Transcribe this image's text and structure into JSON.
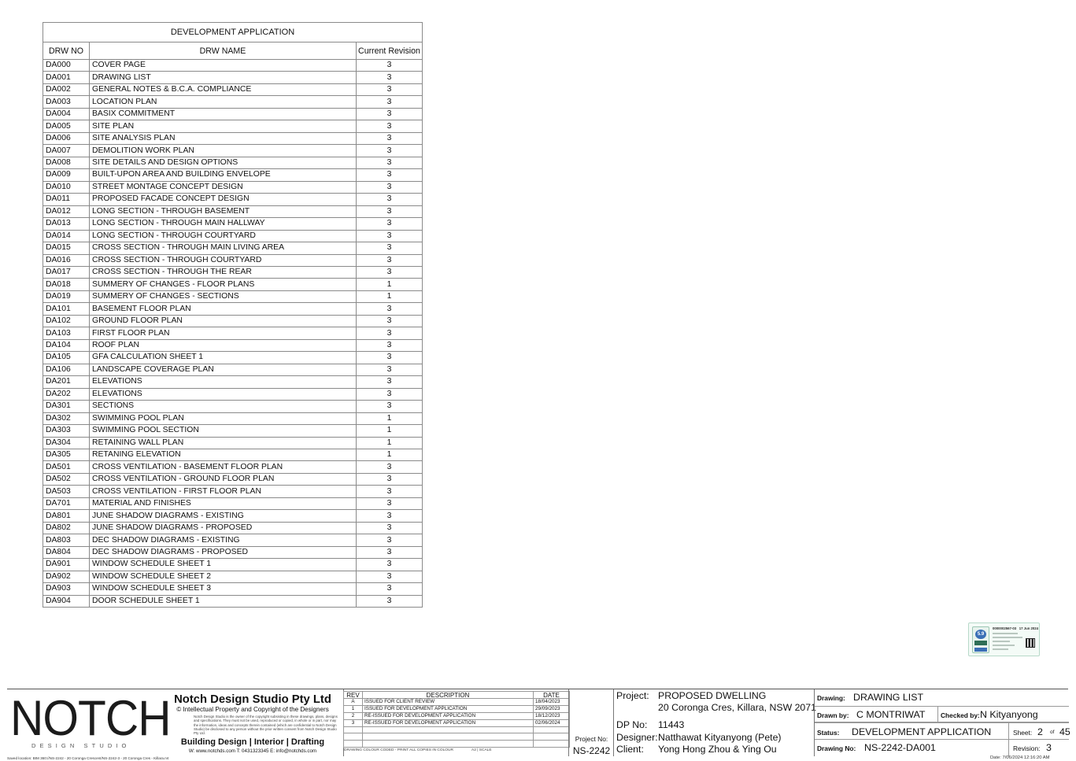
{
  "drawing_list": {
    "caption": "DEVELOPMENT APPLICATION",
    "headers": {
      "no": "DRW NO",
      "name": "DRW NAME",
      "rev": "Current Revision"
    },
    "rows": [
      {
        "no": "DA000",
        "name": "COVER PAGE",
        "rev": "3"
      },
      {
        "no": "DA001",
        "name": "DRAWING LIST",
        "rev": "3"
      },
      {
        "no": "DA002",
        "name": "GENERAL NOTES & B.C.A. COMPLIANCE",
        "rev": "3"
      },
      {
        "no": "DA003",
        "name": "LOCATION PLAN",
        "rev": "3"
      },
      {
        "no": "DA004",
        "name": "BASIX COMMITMENT",
        "rev": "3"
      },
      {
        "no": "DA005",
        "name": "SITE PLAN",
        "rev": "3"
      },
      {
        "no": "DA006",
        "name": "SITE ANALYSIS PLAN",
        "rev": "3"
      },
      {
        "no": "DA007",
        "name": "DEMOLITION WORK PLAN",
        "rev": "3"
      },
      {
        "no": "DA008",
        "name": "SITE DETAILS AND DESIGN OPTIONS",
        "rev": "3"
      },
      {
        "no": "DA009",
        "name": "BUILT-UPON AREA AND BUILDING ENVELOPE",
        "rev": "3"
      },
      {
        "no": "DA010",
        "name": "STREET MONTAGE CONCEPT DESIGN",
        "rev": "3"
      },
      {
        "no": "DA011",
        "name": "PROPOSED FACADE CONCEPT DESIGN",
        "rev": "3"
      },
      {
        "no": "DA012",
        "name": "LONG SECTION - THROUGH BASEMENT",
        "rev": "3"
      },
      {
        "no": "DA013",
        "name": "LONG SECTION - THROUGH MAIN HALLWAY",
        "rev": "3"
      },
      {
        "no": "DA014",
        "name": "LONG SECTION - THROUGH COURTYARD",
        "rev": "3"
      },
      {
        "no": "DA015",
        "name": "CROSS SECTION - THROUGH MAIN LIVING AREA",
        "rev": "3"
      },
      {
        "no": "DA016",
        "name": "CROSS SECTION - THROUGH COURTYARD",
        "rev": "3"
      },
      {
        "no": "DA017",
        "name": "CROSS SECTION - THROUGH THE REAR",
        "rev": "3"
      },
      {
        "no": "DA018",
        "name": "SUMMERY OF CHANGES - FLOOR PLANS",
        "rev": "1"
      },
      {
        "no": "DA019",
        "name": "SUMMERY OF CHANGES - SECTIONS",
        "rev": "1"
      },
      {
        "no": "DA101",
        "name": "BASEMENT FLOOR PLAN",
        "rev": "3"
      },
      {
        "no": "DA102",
        "name": "GROUND FLOOR PLAN",
        "rev": "3"
      },
      {
        "no": "DA103",
        "name": "FIRST FLOOR PLAN",
        "rev": "3"
      },
      {
        "no": "DA104",
        "name": "ROOF PLAN",
        "rev": "3"
      },
      {
        "no": "DA105",
        "name": "GFA CALCULATION SHEET 1",
        "rev": "3"
      },
      {
        "no": "DA106",
        "name": "LANDSCAPE COVERAGE PLAN",
        "rev": "3"
      },
      {
        "no": "DA201",
        "name": "ELEVATIONS",
        "rev": "3"
      },
      {
        "no": "DA202",
        "name": "ELEVATIONS",
        "rev": "3"
      },
      {
        "no": "DA301",
        "name": "SECTIONS",
        "rev": "3"
      },
      {
        "no": "DA302",
        "name": "SWIMMING POOL PLAN",
        "rev": "1"
      },
      {
        "no": "DA303",
        "name": "SWIMMING POOL SECTION",
        "rev": "1"
      },
      {
        "no": "DA304",
        "name": "RETAINING WALL PLAN",
        "rev": "1"
      },
      {
        "no": "DA305",
        "name": "RETANING ELEVATION",
        "rev": "1"
      },
      {
        "no": "DA501",
        "name": "CROSS VENTILATION - BASEMENT FLOOR PLAN",
        "rev": "3"
      },
      {
        "no": "DA502",
        "name": "CROSS VENTILATION - GROUND FLOOR PLAN",
        "rev": "3"
      },
      {
        "no": "DA503",
        "name": "CROSS VENTILATION - FIRST FLOOR PLAN",
        "rev": "3"
      },
      {
        "no": "DA701",
        "name": "MATERIAL AND FINISHES",
        "rev": "3"
      },
      {
        "no": "DA801",
        "name": "JUNE SHADOW DIAGRAMS - EXISTING",
        "rev": "3"
      },
      {
        "no": "DA802",
        "name": "JUNE SHADOW DIAGRAMS - PROPOSED",
        "rev": "3"
      },
      {
        "no": "DA803",
        "name": "DEC SHADOW DIAGRAMS - EXISTING",
        "rev": "3"
      },
      {
        "no": "DA804",
        "name": "DEC SHADOW DIAGRAMS - PROPOSED",
        "rev": "3"
      },
      {
        "no": "DA901",
        "name": "WINDOW SCHEDULE SHEET 1",
        "rev": "3"
      },
      {
        "no": "DA902",
        "name": "WINDOW SCHEDULE SHEET 2",
        "rev": "3"
      },
      {
        "no": "DA903",
        "name": "WINDOW SCHEDULE SHEET 3",
        "rev": "3"
      },
      {
        "no": "DA904",
        "name": "DOOR SCHEDULE SHEET 1",
        "rev": "3"
      }
    ]
  },
  "basix_stamp": {
    "cert_no": "0000002567-03",
    "cert_date": "17 Jun 2024",
    "rating": "5.9",
    "brand": "HOUSE"
  },
  "logo": {
    "word": "NOTCH",
    "sub": "DESIGN STUDIO"
  },
  "company": {
    "name": "Notch Design Studio Pty Ltd",
    "copyright": "© Intellectual Property and Copyright of the Designers",
    "disclaimer": "Notch Design Studio is the owner of the copyright subsisting in these drawings, plans, designs and specifications. They must not be used, reproduced or copied, in whole or in part, nor may the information, ideas and concepts therein contained (which are confidential to Notch Design Studio) be disclosed to any person without the prior written consent from Notch Design Studio Pty Ltd.",
    "services": "Building Design | Interior | Drafting",
    "contact": "W: www.notchds.com  T: 0431323345  E: info@notchds.com"
  },
  "revisions": {
    "headers": {
      "rev": "REV",
      "desc": "DESCRIPTION",
      "date": "DATE"
    },
    "rows": [
      {
        "rev": "A",
        "desc": "ISSUED FOR CLIENT REVIEW",
        "date": "18/04/2023"
      },
      {
        "rev": "1",
        "desc": "ISSUED FOR DEVELOPMENT APPLICATION",
        "date": "29/09/2023"
      },
      {
        "rev": "2",
        "desc": "RE-ISSUED FOR DEVELOPMENT APPLICATION",
        "date": "18/12/2023"
      },
      {
        "rev": "3",
        "desc": "RE-ISSUED FOR DEVELOPMENT APPLICATION",
        "date": "02/06/2024"
      }
    ],
    "footer_note": "DRAWING COLOUR CODED - PRINT ALL COPIES IN COLOUR",
    "paper": "A2",
    "scale_label": "SCALE"
  },
  "project_no": {
    "label": "Project No:",
    "value": "NS-2242"
  },
  "project": {
    "project_label": "Project:",
    "project_name": "PROPOSED DWELLING",
    "address": "20 Coronga Cres, Killara, NSW 2071",
    "dp_label": "DP No:",
    "dp_value": "11443",
    "designer_label": "Designer:",
    "designer_value": "Natthawat Kityanyong (Pete)",
    "client_label": "Client:",
    "client_value": "Yong Hong Zhou & Ying Ou"
  },
  "drawing": {
    "drawing_label": "Drawing:",
    "drawing_value": "DRAWING LIST",
    "drawn_label": "Drawn by:",
    "drawn_value": "C MONTRIWAT",
    "checked_label": "Checked by:",
    "checked_value": "N Kityanyong",
    "status_label": "Status:",
    "status_value": "DEVELOPMENT APPLICATION",
    "sheet_label": "Sheet:",
    "sheet_value": "2",
    "of_label": "of",
    "sheet_total": "45",
    "drawing_no_label": "Drawing No:",
    "drawing_no_value": "NS-2242-DA001",
    "revision_label": "Revision:",
    "revision_value": "3"
  },
  "saved_location": "Saved location:  BIM 360://NS-2242 - 20 Coronga Crescent/NS-2242-3 - 20 Coronga Cres - Killara.rvt",
  "print_date": "Date:  7/06/2024 12:16:20 AM"
}
